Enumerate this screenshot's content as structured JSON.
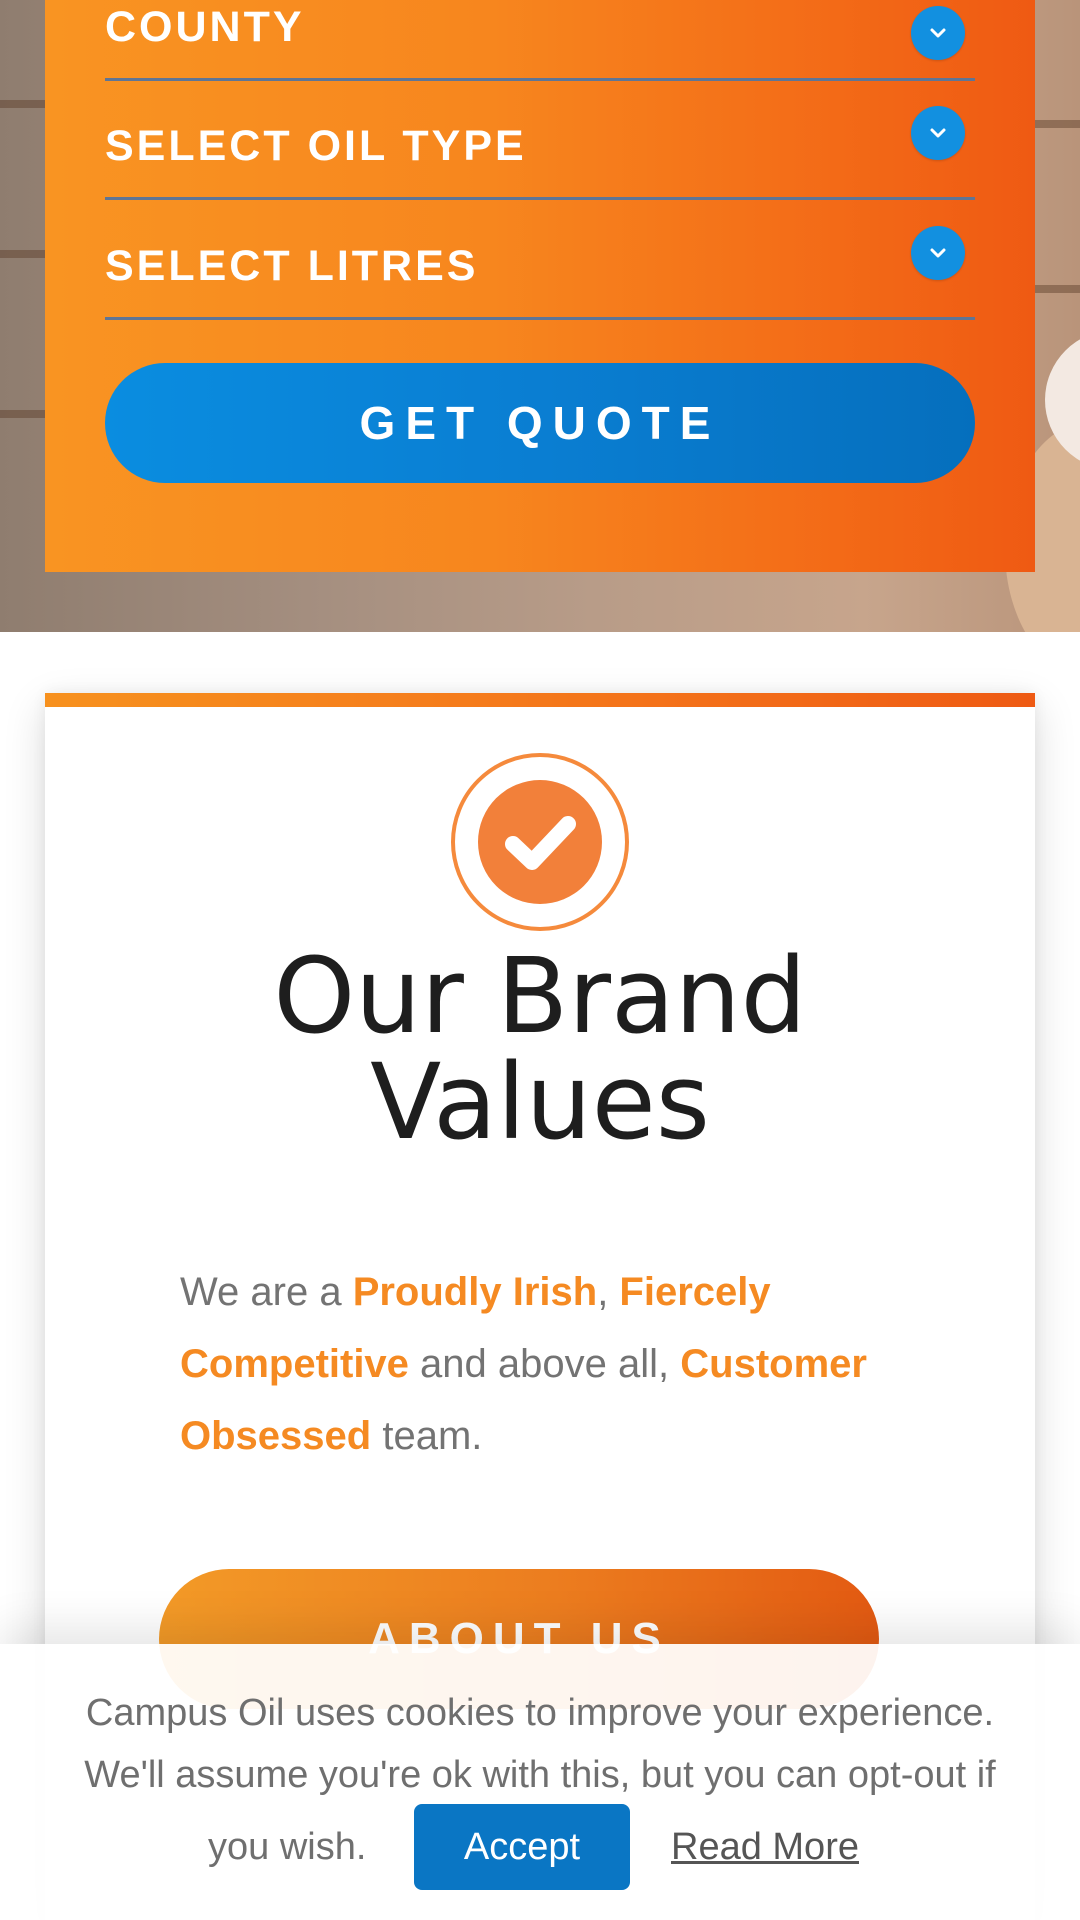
{
  "quote_form": {
    "fields": [
      {
        "label": "COUNTY"
      },
      {
        "label": "SELECT OIL TYPE"
      },
      {
        "label": "SELECT LITRES"
      }
    ],
    "submit_label": "GET QUOTE"
  },
  "brand_values": {
    "title_line1": "Our Brand",
    "title_line2": "Values",
    "text": {
      "part1": "We are a ",
      "hl1": "Proudly Irish",
      "part2": ", ",
      "hl2": "Fiercely Competitive",
      "part3": " and above all, ",
      "hl3": "Customer Obsessed",
      "part4": " team."
    },
    "button_label": "ABOUT US",
    "icon": "checkmark-circle-icon"
  },
  "cookie_banner": {
    "line1": "Campus Oil uses cookies to improve your experience.",
    "line2": "We'll assume you're ok with this, but you can opt-out if",
    "line3": "you wish.",
    "accept_label": "Accept",
    "read_more_label": "Read More"
  },
  "colors": {
    "accent_orange": "#f58a22",
    "accent_blue": "#0a76c4",
    "title_text": "#1e1e1e",
    "body_text": "#737373"
  }
}
